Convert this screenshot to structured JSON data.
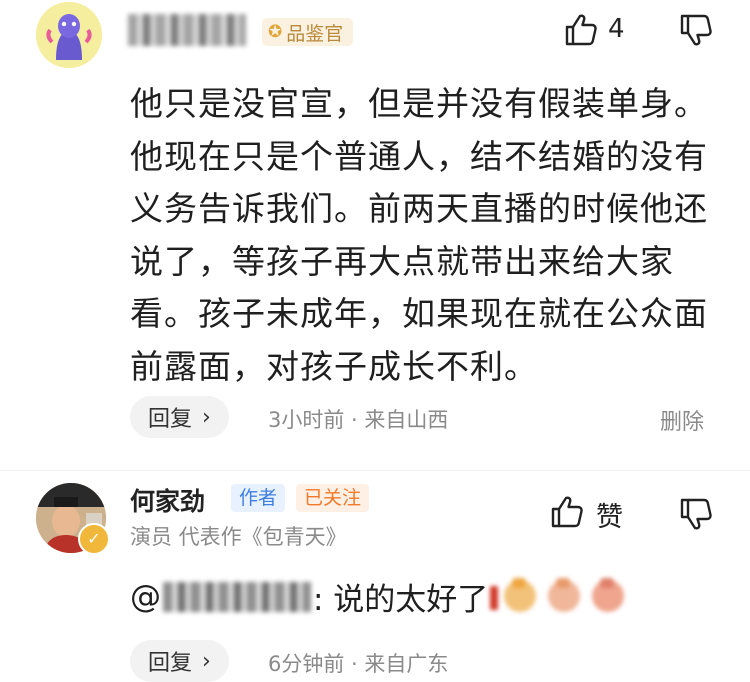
{
  "comment1": {
    "badge_label": "品鉴官",
    "like_count": "4",
    "text": "他只是没官宣，但是并没有假装单身。他现在只是个普通人，结不结婚的没有义务告诉我们。前两天直播的时候他还说了，等孩子再大点就带出来给大家看。孩子未成年，如果现在就在公众面前露面，对孩子成长不利。",
    "reply_label": "回复",
    "time_location": "3小时前 · 来自山西",
    "delete_label": "删除"
  },
  "comment2": {
    "author_name": "何家劲",
    "author_tag": "作者",
    "followed_tag": "已关注",
    "author_desc": "演员 代表作《包青天》",
    "like_label": "赞",
    "at_symbol": "@",
    "text": ": 说的太好了",
    "reply_label": "回复",
    "time_location": "6分钟前 · 来自广东"
  },
  "colors": {
    "badge_text": "#b98a3c",
    "author_tag": "#3f7fe0",
    "followed_tag": "#f07a2a",
    "meta_text": "#8a8a8a"
  }
}
